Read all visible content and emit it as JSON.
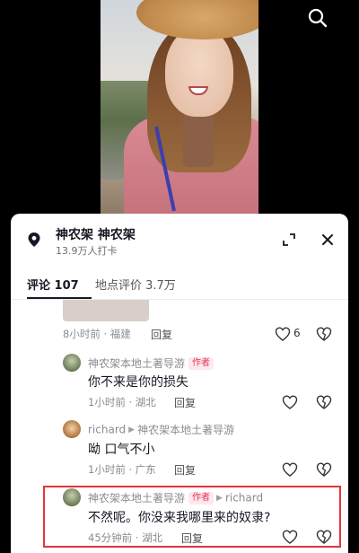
{
  "video": {
    "search_icon": "search-icon"
  },
  "location": {
    "title": "神农架  神农架",
    "subtitle": "13.9万人打卡",
    "pin_icon": "location-pin-icon",
    "expand_icon": "expand-icon",
    "close_icon": "close-icon"
  },
  "tabs": {
    "comments": "评论 107",
    "reviews": "地点评价 3.7万"
  },
  "comments": {
    "c0": {
      "meta": "8小时前 · 福建",
      "reply": "回复",
      "likes": "6"
    },
    "c1": {
      "author": "神农架本地土著导游",
      "badge": "作者",
      "text": "你不来是你的损失",
      "meta": "1小时前 · 湖北",
      "reply": "回复"
    },
    "c2": {
      "author": "richard",
      "reply_to": "神农架本地土著导游",
      "text": "呦 口气不小",
      "meta": "1小时前 · 广东",
      "reply": "回复"
    },
    "c3": {
      "author": "神农架本地土著导游",
      "badge": "作者",
      "reply_to": "richard",
      "text": "不然呢。你没来我哪里来的奴隶?",
      "meta": "45分钟前 · 湖北",
      "reply": "回复"
    }
  },
  "colors": {
    "accent_badge": "#e8345a",
    "highlight_border": "#e3333f"
  }
}
